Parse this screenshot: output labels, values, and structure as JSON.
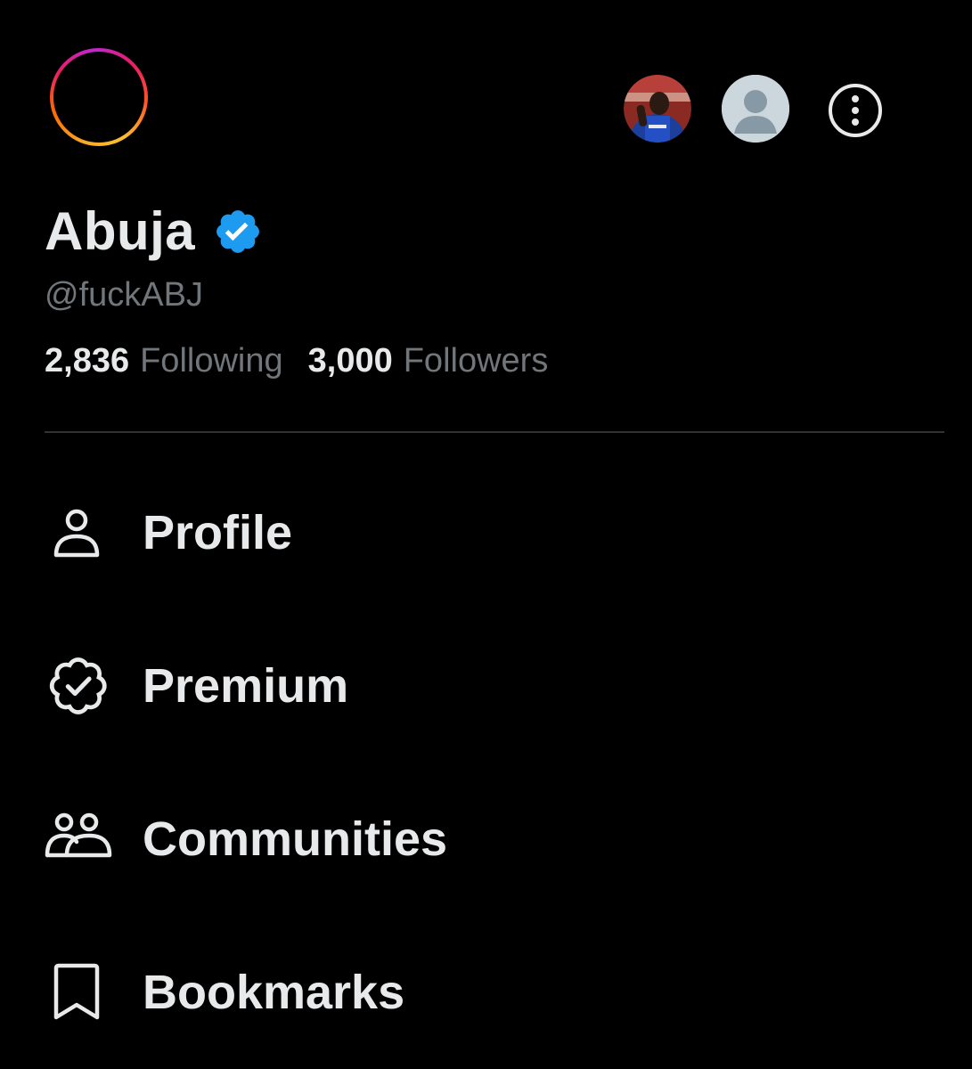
{
  "profile": {
    "display_name": "Abuja",
    "handle": "@fuckABJ",
    "following_count": "2,836",
    "following_label": "Following",
    "followers_count": "3,000",
    "followers_label": "Followers"
  },
  "header": {
    "main_avatar_ring_colors": [
      "#f9a825",
      "#ff6a00",
      "#e91e63",
      "#c026d3"
    ],
    "account_switcher": [
      {
        "kind": "photo",
        "icon": "account-photo-avatar"
      },
      {
        "kind": "default",
        "icon": "default-avatar-icon"
      }
    ],
    "more_icon": "more-vertical-icon"
  },
  "nav": {
    "items": [
      {
        "label": "Profile",
        "icon": "person-icon"
      },
      {
        "label": "Premium",
        "icon": "verified-badge-icon"
      },
      {
        "label": "Communities",
        "icon": "people-icon"
      },
      {
        "label": "Bookmarks",
        "icon": "bookmark-icon"
      }
    ]
  },
  "colors": {
    "background": "#000000",
    "primary_text": "#e7e9ea",
    "secondary_text": "#71767b",
    "verified_blue": "#1d9bf0",
    "divider": "#2f3336"
  }
}
